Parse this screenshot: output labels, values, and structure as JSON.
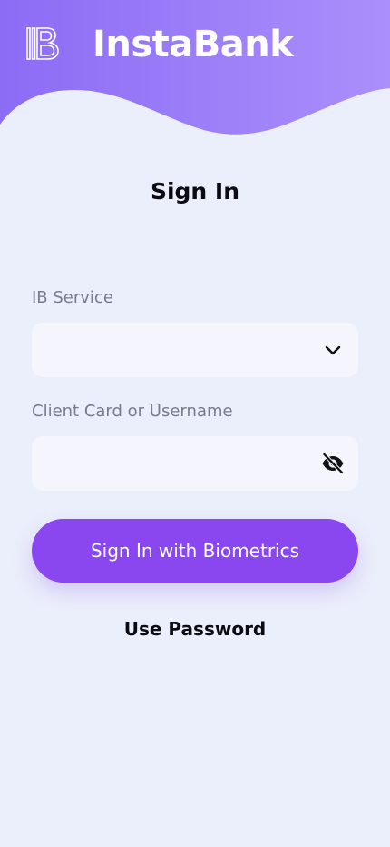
{
  "header": {
    "brand_name": "InstaBank",
    "logo_icon": "ib-logo-icon",
    "gradient_start": "#8b6cf5",
    "gradient_end": "#ab8ffb"
  },
  "page": {
    "title": "Sign In"
  },
  "form": {
    "service_label": "IB Service",
    "service_value": "",
    "service_icon": "chevron-down-icon",
    "username_label": "Client Card or Username",
    "username_value": "",
    "username_icon": "eye-off-icon"
  },
  "actions": {
    "biometrics_label": "Sign In with Biometrics",
    "password_label": "Use Password",
    "accent_color": "#8a47ef"
  }
}
